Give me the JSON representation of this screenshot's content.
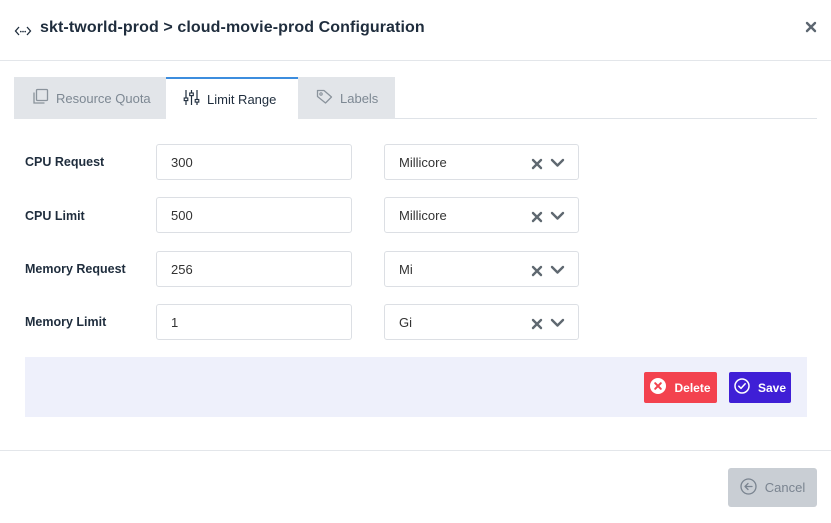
{
  "header": {
    "title": "skt-tworld-prod > cloud-movie-prod Configuration",
    "icon": "code-icon"
  },
  "tabs": [
    {
      "label": "Resource Quota",
      "icon": "copy-icon",
      "active": false
    },
    {
      "label": "Limit Range",
      "icon": "sliders-icon",
      "active": true
    },
    {
      "label": "Labels",
      "icon": "tag-icon",
      "active": false
    }
  ],
  "rows": [
    {
      "label": "CPU Request",
      "value": "300",
      "unit": "Millicore"
    },
    {
      "label": "CPU Limit",
      "value": "500",
      "unit": "Millicore"
    },
    {
      "label": "Memory Request",
      "value": "256",
      "unit": "Mi"
    },
    {
      "label": "Memory Limit",
      "value": "1",
      "unit": "Gi"
    }
  ],
  "actions": {
    "delete_label": "Delete",
    "save_label": "Save"
  },
  "footer": {
    "cancel_label": "Cancel"
  },
  "colors": {
    "delete": "#f3424e",
    "save": "#3f1fd6",
    "action_bar_bg": "#eef0fb",
    "tab_active_border": "#3c8dde"
  }
}
